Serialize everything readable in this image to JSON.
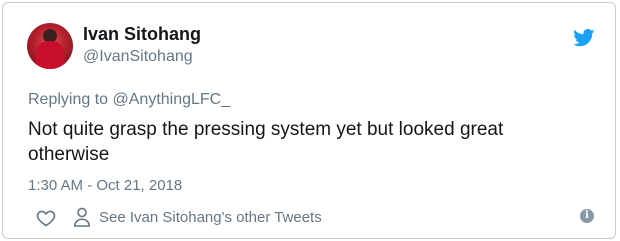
{
  "author": {
    "name": "Ivan Sitohang",
    "handle": "@IvanSitohang"
  },
  "reply": {
    "prefix": "Replying to ",
    "mention": "@AnythingLFC_"
  },
  "tweet": {
    "text": "Not quite grasp the pressing system yet but looked great otherwise",
    "timestamp": "1:30 AM - Oct 21, 2018"
  },
  "actions": {
    "other_tweets": "See Ivan Sitohang's other Tweets"
  },
  "icons": {
    "brand": "twitter-bird-icon",
    "like": "heart-icon",
    "profile": "person-icon",
    "info": "info-icon"
  },
  "colors": {
    "brand": "#1da1f2",
    "secondary_text": "#657786",
    "primary_text": "#14171a"
  }
}
